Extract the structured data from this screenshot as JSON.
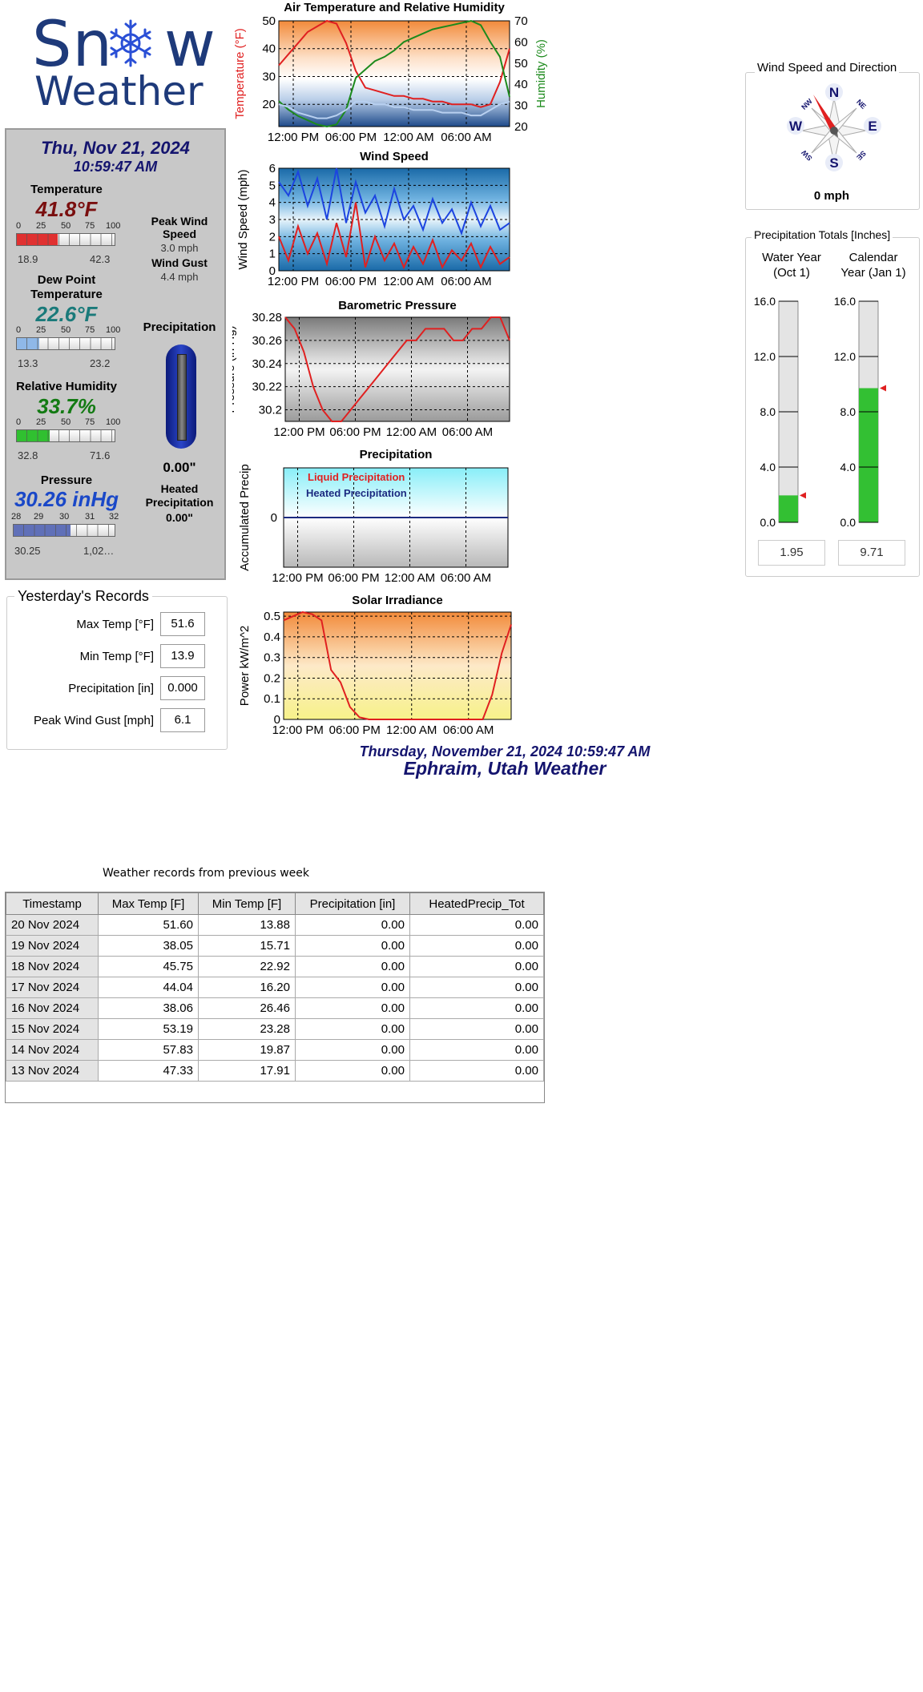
{
  "logo": {
    "word1": "Sn",
    "word1b": "w",
    "word2": "Weather"
  },
  "current": {
    "date": "Thu, Nov 21, 2024",
    "time": "10:59:47 AM",
    "temperature": {
      "label": "Temperature",
      "value": "41.8°F",
      "min": "18.9",
      "max": "42.3",
      "level": 0.418,
      "color": "#7a0f0f",
      "fill": "#e03030"
    },
    "dewpoint": {
      "label": "Dew Point Temperature",
      "value": "22.6°F",
      "min": "13.3",
      "max": "23.2",
      "level": 0.226,
      "color": "#1a7a7a",
      "fill": "#8fb8e8"
    },
    "humidity": {
      "label": "Relative Humidity",
      "value": "33.7%",
      "min": "32.8",
      "max": "71.6",
      "level": 0.337,
      "color": "#137a13",
      "fill": "#30c030"
    },
    "pressure": {
      "label": "Pressure",
      "value": "30.26 inHg",
      "min": "30.25",
      "max": "1,02…",
      "level": 0.565,
      "color": "#1a48c8",
      "fill": "#6070b8",
      "ticks": [
        "28",
        "29",
        "30",
        "31",
        "32"
      ]
    },
    "scale_ticks": [
      "0",
      "25",
      "50",
      "75",
      "100"
    ],
    "peak_wind_label": "Peak Wind Speed",
    "peak_wind_value": "3.0 mph",
    "wind_gust_label": "Wind Gust",
    "wind_gust_value": "4.4 mph",
    "precip_label": "Precipitation",
    "precip_value": "0.00\"",
    "heated_label": "Heated Precipitation",
    "heated_value": "0.00\""
  },
  "yesterday": {
    "title": "Yesterday's Records",
    "rows": [
      {
        "label": "Max Temp [°F]",
        "value": "51.6"
      },
      {
        "label": "Min Temp [°F]",
        "value": "13.9"
      },
      {
        "label": "Precipitation [in]",
        "value": "0.000"
      },
      {
        "label": "Peak Wind Gust [mph]",
        "value": "6.1"
      }
    ]
  },
  "wind_widget": {
    "title": "Wind Speed and Direction",
    "speed": "0 mph",
    "direction_deg": 330,
    "cardinals": [
      "N",
      "E",
      "S",
      "W"
    ],
    "intercardinals": [
      "NE",
      "SE",
      "SW",
      "NW"
    ]
  },
  "precip_totals": {
    "title": "Precipitation Totals [Inches]",
    "gauges": [
      {
        "label1": "Water Year",
        "label2": "(Oct 1)",
        "value": "1.95",
        "level": 1.95
      },
      {
        "label1": "Calendar",
        "label2": "Year (Jan 1)",
        "value": "9.71",
        "level": 9.71
      }
    ],
    "ticks": [
      "16.0",
      "12.0",
      "8.0",
      "4.0",
      "0.0"
    ],
    "max": 16
  },
  "time_ticks": [
    "12:00 PM",
    "06:00 PM",
    "12:00 AM",
    "06:00 AM"
  ],
  "chart_data": [
    {
      "type": "line",
      "title": "Air Temperature and Relative Humidity",
      "ylabel": "Temperature (°F)",
      "y2label": "Humidity (%)",
      "ylim": [
        12,
        50
      ],
      "y2lim": [
        20,
        70
      ],
      "yticks": [
        "50",
        "40",
        "30",
        "20"
      ],
      "y2ticks": [
        "70",
        "60",
        "50",
        "40",
        "30",
        "20"
      ],
      "series": [
        {
          "x": [
            0,
            1,
            2,
            3,
            4,
            5,
            6,
            7,
            8,
            9,
            10,
            11,
            12,
            13,
            14,
            15,
            16,
            17,
            18,
            19,
            20,
            21,
            22,
            23,
            24
          ],
          "values": [
            34,
            38,
            42,
            46,
            48,
            50,
            49,
            42,
            32,
            26,
            25,
            24,
            23,
            23,
            22,
            22,
            21,
            21,
            20,
            20,
            20,
            19,
            20,
            28,
            40
          ],
          "color": "#e02020",
          "axis": "left"
        },
        {
          "x": [
            0,
            1,
            2,
            3,
            4,
            5,
            6,
            7,
            8,
            9,
            10,
            11,
            12,
            13,
            14,
            15,
            16,
            17,
            18,
            19,
            20,
            21,
            22,
            23,
            24
          ],
          "values": [
            32,
            28,
            25,
            23,
            21,
            20,
            21,
            28,
            43,
            47,
            51,
            53,
            56,
            60,
            62,
            64,
            66,
            67,
            68,
            69,
            70,
            68,
            60,
            53,
            34
          ],
          "color": "#1c8a1c",
          "axis": "right"
        },
        {
          "x": [
            0,
            1,
            2,
            3,
            4,
            5,
            6,
            7,
            8,
            9,
            10,
            11,
            12,
            13,
            14,
            15,
            16,
            17,
            18,
            19,
            20,
            21,
            22,
            23,
            24
          ],
          "values": [
            20,
            19,
            17,
            16,
            15,
            15,
            16,
            18,
            21,
            21,
            20,
            20,
            19,
            19,
            18,
            18,
            18,
            17,
            17,
            17,
            16,
            16,
            18,
            20,
            21
          ],
          "color": "#b8d0f0",
          "axis": "left"
        }
      ]
    },
    {
      "type": "line",
      "title": "Wind Speed",
      "ylabel": "Wind Speed (mph)",
      "ylim": [
        0,
        6
      ],
      "yticks": [
        "6",
        "5",
        "4",
        "3",
        "2",
        "1",
        "0"
      ],
      "series": [
        {
          "x": [
            0,
            1,
            2,
            3,
            4,
            5,
            6,
            7,
            8,
            9,
            10,
            11,
            12,
            13,
            14,
            15,
            16,
            17,
            18,
            19,
            20,
            21,
            22,
            23,
            24
          ],
          "values": [
            5.2,
            4.4,
            5.8,
            3.8,
            5.4,
            3.0,
            6.0,
            2.8,
            5.2,
            3.4,
            4.4,
            2.6,
            4.8,
            3.0,
            3.8,
            2.4,
            4.2,
            2.8,
            3.6,
            2.2,
            4.0,
            2.6,
            3.8,
            2.4,
            2.8
          ],
          "color": "#1c44e0"
        },
        {
          "x": [
            0,
            1,
            2,
            3,
            4,
            5,
            6,
            7,
            8,
            9,
            10,
            11,
            12,
            13,
            14,
            15,
            16,
            17,
            18,
            19,
            20,
            21,
            22,
            23,
            24
          ],
          "values": [
            2.0,
            0.6,
            2.6,
            1.0,
            2.2,
            0.4,
            2.8,
            0.8,
            4.0,
            0.2,
            2.0,
            0.6,
            1.6,
            0.2,
            1.4,
            0.4,
            1.8,
            0.2,
            1.2,
            0.6,
            1.6,
            0.2,
            1.4,
            0.4,
            0.8
          ],
          "color": "#e02020"
        }
      ]
    },
    {
      "type": "line",
      "title": "Barometric Pressure",
      "ylabel": "Pressure (in Hg)",
      "ylim": [
        30.19,
        30.28
      ],
      "yticks": [
        "30.28",
        "30.26",
        "30.24",
        "30.22",
        "30.2"
      ],
      "series": [
        {
          "x": [
            0,
            1,
            2,
            3,
            4,
            5,
            6,
            7,
            8,
            9,
            10,
            11,
            12,
            13,
            14,
            15,
            16,
            17,
            18,
            19,
            20,
            21,
            22,
            23,
            24
          ],
          "values": [
            30.28,
            30.27,
            30.25,
            30.22,
            30.2,
            30.19,
            30.19,
            30.2,
            30.21,
            30.22,
            30.23,
            30.24,
            30.25,
            30.26,
            30.26,
            30.27,
            30.27,
            30.27,
            30.26,
            30.26,
            30.27,
            30.27,
            30.28,
            30.28,
            30.26
          ],
          "color": "#e02020"
        }
      ]
    },
    {
      "type": "line",
      "title": "Precipitation",
      "ylabel": "Accumulated Precip",
      "yticks": [
        "0"
      ],
      "legend": [
        "Liquid Precipitation",
        "Heated Precipitation"
      ],
      "series": [
        {
          "name": "Liquid Precipitation",
          "x": [
            0,
            24
          ],
          "values": [
            0,
            0
          ],
          "color": "#e02020"
        },
        {
          "name": "Heated Precipitation",
          "x": [
            0,
            24
          ],
          "values": [
            0,
            0
          ],
          "color": "#1c2a80"
        }
      ]
    },
    {
      "type": "line",
      "title": "Solar Irradiance",
      "ylabel": "Power kW/m^2",
      "ylim": [
        0,
        0.52
      ],
      "yticks": [
        "0.5",
        "0.4",
        "0.3",
        "0.2",
        "0.1",
        "0"
      ],
      "series": [
        {
          "x": [
            0,
            1,
            2,
            3,
            4,
            5,
            6,
            7,
            8,
            9,
            10,
            11,
            12,
            13,
            14,
            15,
            16,
            17,
            18,
            19,
            20,
            21,
            22,
            23,
            24
          ],
          "values": [
            0.48,
            0.5,
            0.52,
            0.51,
            0.48,
            0.24,
            0.18,
            0.06,
            0.01,
            0,
            0,
            0,
            0,
            0,
            0,
            0,
            0,
            0,
            0,
            0,
            0,
            0,
            0.12,
            0.32,
            0.46
          ],
          "color": "#e02020"
        }
      ]
    }
  ],
  "footer": {
    "datetime": "Thursday, November 21, 2024 10:59:47 AM",
    "location": "Ephraim, Utah Weather"
  },
  "weekly": {
    "title": "Weather records from previous week",
    "headers": [
      "Timestamp",
      "Max Temp [F]",
      "Min Temp [F]",
      "Precipitation [in]",
      "HeatedPrecip_Tot"
    ],
    "rows": [
      [
        "20 Nov 2024",
        "51.60",
        "13.88",
        "0.00",
        "0.00"
      ],
      [
        "19 Nov 2024",
        "38.05",
        "15.71",
        "0.00",
        "0.00"
      ],
      [
        "18 Nov 2024",
        "45.75",
        "22.92",
        "0.00",
        "0.00"
      ],
      [
        "17 Nov 2024",
        "44.04",
        "16.20",
        "0.00",
        "0.00"
      ],
      [
        "16 Nov 2024",
        "38.06",
        "26.46",
        "0.00",
        "0.00"
      ],
      [
        "15 Nov 2024",
        "53.19",
        "23.28",
        "0.00",
        "0.00"
      ],
      [
        "14 Nov 2024",
        "57.83",
        "19.87",
        "0.00",
        "0.00"
      ],
      [
        "13 Nov 2024",
        "47.33",
        "17.91",
        "0.00",
        "0.00"
      ]
    ]
  }
}
